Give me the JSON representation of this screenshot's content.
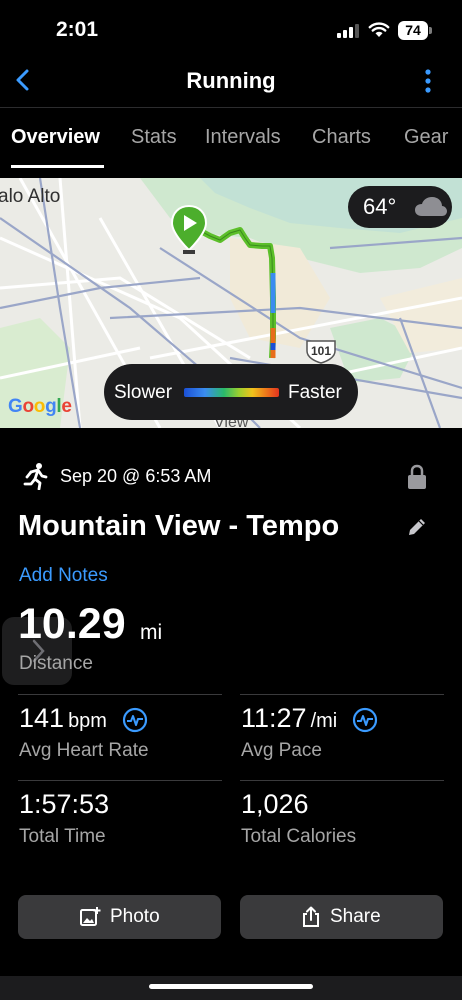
{
  "status_bar": {
    "time": "2:01",
    "battery": "74"
  },
  "header": {
    "title": "Running"
  },
  "tabs": [
    "Overview",
    "Stats",
    "Intervals",
    "Charts",
    "Gear"
  ],
  "active_tab": "Overview",
  "map": {
    "city_label": "alo Alto",
    "bottom_label": "View",
    "highway": "101",
    "weather_temp": "64°",
    "weather_icon": "cloud-icon",
    "provider": "Google",
    "legend_slower": "Slower",
    "legend_faster": "Faster"
  },
  "activity": {
    "date": "Sep 20 @ 6:53 AM",
    "title": "Mountain View - Tempo",
    "add_notes": "Add Notes",
    "distance_value": "10.29",
    "distance_unit": "mi",
    "distance_label": "Distance"
  },
  "stats": [
    {
      "value": "141",
      "unit": "bpm",
      "label": "Avg Heart Rate"
    },
    {
      "value": "11:27",
      "unit": "/mi",
      "label": "Avg Pace"
    },
    {
      "value": "1:57:53",
      "unit": "",
      "label": "Total Time"
    },
    {
      "value": "1,026",
      "unit": "",
      "label": "Total Calories"
    }
  ],
  "actions": {
    "photo": "Photo",
    "share": "Share"
  },
  "colors": {
    "accent": "#3b9bff",
    "background": "#000000",
    "button_bg": "#3a3a3c",
    "route_green": "#5cbf2a"
  }
}
